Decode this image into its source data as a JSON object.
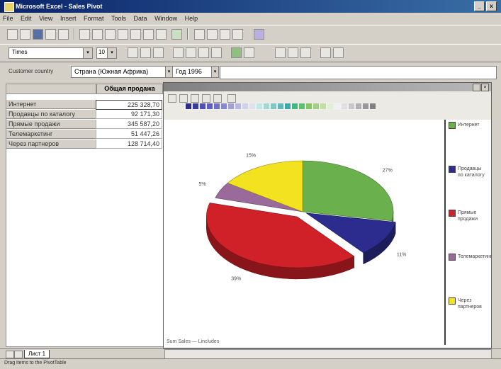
{
  "window": {
    "title": "Microsoft Excel - Sales Pivot",
    "controls": [
      "_",
      "x"
    ]
  },
  "menu": [
    "File",
    "Edit",
    "View",
    "Insert",
    "Format",
    "Tools",
    "Data",
    "Window",
    "Help"
  ],
  "format_toolbar": {
    "font": "Times",
    "size": "10"
  },
  "filters": {
    "label": "Customer country",
    "country": "Страна (Южная Африка)",
    "year": "Год 1996"
  },
  "grid": {
    "header": "Общая продажа",
    "rows": [
      {
        "label": "Интернет",
        "value": "225 328,70"
      },
      {
        "label": "Продавцы по каталогу",
        "value": "92 171,30"
      },
      {
        "label": "Прямые продажи",
        "value": "345 587,20"
      },
      {
        "label": "Телемаркетинг",
        "value": "51 447,26"
      },
      {
        "label": "Через партнеров",
        "value": "128 714,40"
      }
    ]
  },
  "colors": {
    "green": "#6ab04c",
    "navy": "#2c2c8e",
    "red": "#d02028",
    "mauve": "#9a6a9a",
    "yellow": "#f2e220"
  },
  "chart_data": {
    "type": "pie",
    "categories": [
      "Интернет",
      "Продавцы по каталогу",
      "Прямые продажи",
      "Телемаркетинг",
      "Через партнеров"
    ],
    "values": [
      27,
      11,
      39,
      5,
      15
    ],
    "value_labels": [
      "27%",
      "11%",
      "39%",
      "5%",
      "15%"
    ]
  },
  "chart_legend": [
    {
      "label": "Интернет"
    },
    {
      "label": "Продавцы по каталогу"
    },
    {
      "label": "Прямые продажи"
    },
    {
      "label": "Телемаркетинг"
    },
    {
      "label": "Через партнеров"
    }
  ],
  "chart_status": "Sum Sales — Lincludes",
  "sheet_tab": "Лист 1",
  "statusbar": "Drag items to the PivotTable"
}
